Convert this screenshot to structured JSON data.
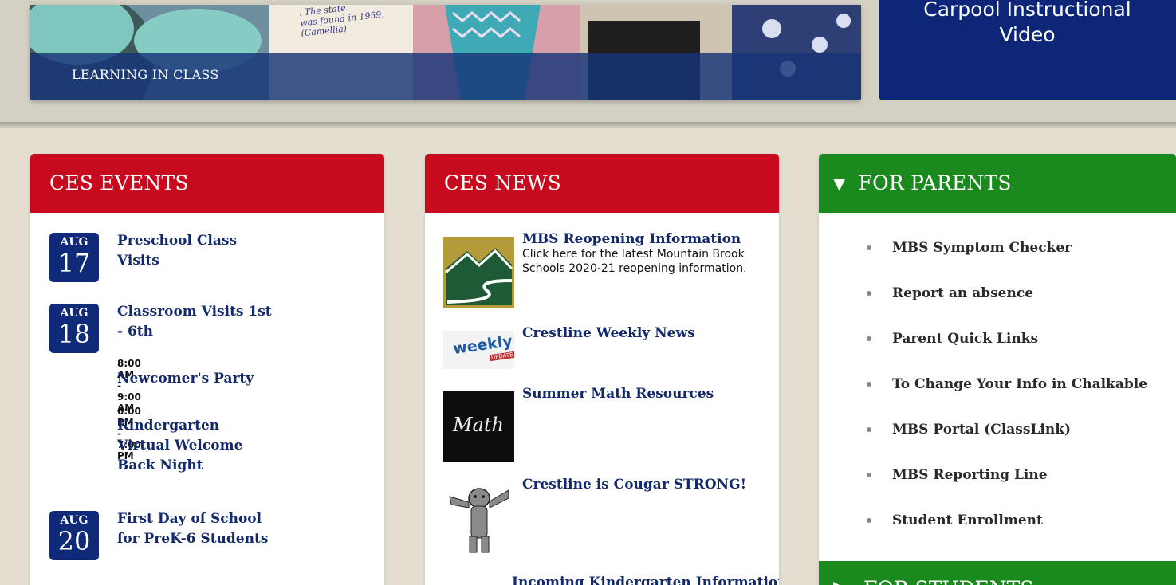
{
  "hero": {
    "caption": "LEARNING IN CLASS",
    "photo_text": ". The state\nwas found in 1959.\n(Camellia)"
  },
  "carpool": {
    "line1": "Carpool Instructional",
    "line2": "Video"
  },
  "events": {
    "heading": "CES EVENTS",
    "items": [
      {
        "month": "AUG",
        "day": "17",
        "entries": [
          {
            "time": "",
            "title": "Preschool Class\nVisits"
          }
        ]
      },
      {
        "month": "AUG",
        "day": "18",
        "entries": [
          {
            "time": "",
            "title": "Classroom Visits 1st\n- 6th"
          },
          {
            "time": "8:00 AM - 9:00 AM",
            "title": "Newcomer's Party"
          },
          {
            "time": "6:00 PM - 7:00 PM",
            "title": "Kindergarten\nVirtual Welcome\nBack Night"
          }
        ]
      },
      {
        "month": "AUG",
        "day": "20",
        "entries": [
          {
            "time": "",
            "title": "First Day of School\nfor PreK-6 Students"
          }
        ]
      }
    ]
  },
  "news": {
    "heading": "CES NEWS",
    "items": [
      {
        "title": "MBS Reopening Information",
        "desc": "Click here for the latest Mountain Brook Schools 2020-21 reopening information.",
        "thumb": "mountain-logo"
      },
      {
        "title": "Crestline Weekly News",
        "desc": "",
        "thumb": "weekly-update",
        "thumb_text": "weekly",
        "thumb_subtext": "UPDATE"
      },
      {
        "title": "Summer Math Resources",
        "desc": "",
        "thumb": "math-chalkboard",
        "thumb_text": "Math"
      },
      {
        "title": "Crestline is Cougar STRONG!",
        "desc": "",
        "thumb": "cougar-mascot"
      },
      {
        "title": "Incoming Kindergarten Information",
        "desc": "",
        "thumb": ""
      }
    ]
  },
  "parents": {
    "heading": "FOR PARENTS",
    "items": [
      "MBS Symptom Checker",
      "Report an absence",
      "Parent Quick Links",
      "To Change Your Info in Chalkable",
      "MBS Portal (ClassLink)",
      "MBS Reporting Line",
      "Student Enrollment"
    ]
  },
  "students": {
    "heading": "FOR STUDENTS"
  },
  "colors": {
    "navy": "#0d2678",
    "red": "#c80a1e",
    "green": "#1a8a1f",
    "background": "#e3ded0"
  }
}
